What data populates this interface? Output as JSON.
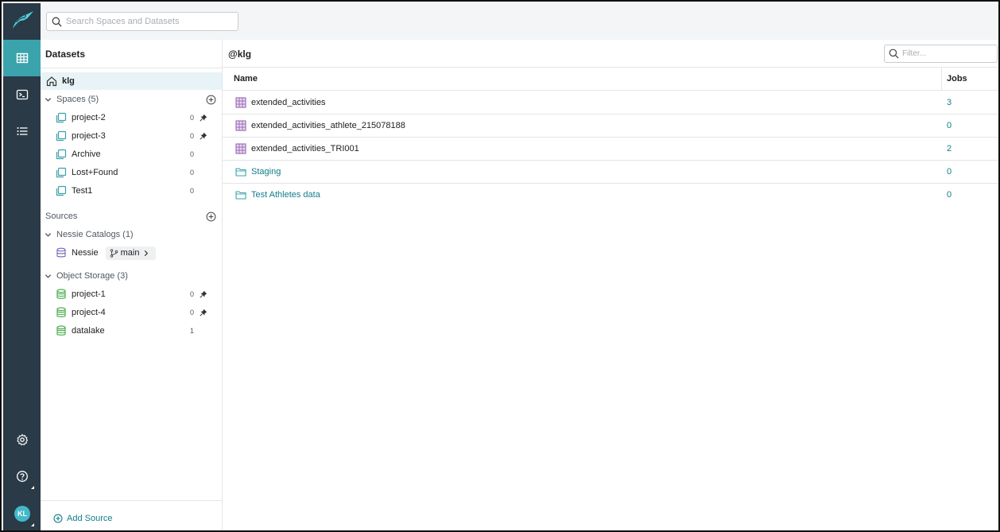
{
  "search": {
    "placeholder": "Search Spaces and Datasets"
  },
  "avatar": {
    "initials": "KL"
  },
  "left_panel": {
    "title": "Datasets",
    "home": {
      "label": "klg"
    },
    "spaces": {
      "label": "Spaces (5)",
      "items": [
        {
          "label": "project-2",
          "count": "0",
          "pinned": true
        },
        {
          "label": "project-3",
          "count": "0",
          "pinned": true
        },
        {
          "label": "Archive",
          "count": "0",
          "pinned": false
        },
        {
          "label": "Lost+Found",
          "count": "0",
          "pinned": false
        },
        {
          "label": "Test1",
          "count": "0",
          "pinned": false
        }
      ]
    },
    "sources": {
      "label": "Sources"
    },
    "nessie": {
      "label": "Nessie Catalogs (1)",
      "item": {
        "label": "Nessie",
        "branch": "main"
      }
    },
    "object_storage": {
      "label": "Object Storage (3)",
      "items": [
        {
          "label": "project-1",
          "count": "0",
          "pinned": true
        },
        {
          "label": "project-4",
          "count": "0",
          "pinned": true
        },
        {
          "label": "datalake",
          "count": "1",
          "pinned": false
        }
      ]
    },
    "add_source": "Add Source"
  },
  "main": {
    "title": "@klg",
    "filter_placeholder": "Filter...",
    "columns": {
      "name": "Name",
      "jobs": "Jobs"
    },
    "rows": [
      {
        "name": "extended_activities",
        "jobs": "3",
        "type": "dataset"
      },
      {
        "name": "extended_activities_athlete_215078188",
        "jobs": "0",
        "type": "dataset"
      },
      {
        "name": "extended_activities_TRI001",
        "jobs": "2",
        "type": "dataset"
      },
      {
        "name": "Staging",
        "jobs": "0",
        "type": "folder"
      },
      {
        "name": "Test Athletes data",
        "jobs": "0",
        "type": "folder"
      }
    ]
  },
  "colors": {
    "rail": "#2a3a47",
    "rail_active": "#3aa3ac",
    "accent": "#137c8b",
    "dataset_icon": "#8e5aab",
    "space_icon": "#3aa3ac",
    "storage_icon": "#4caf50"
  }
}
